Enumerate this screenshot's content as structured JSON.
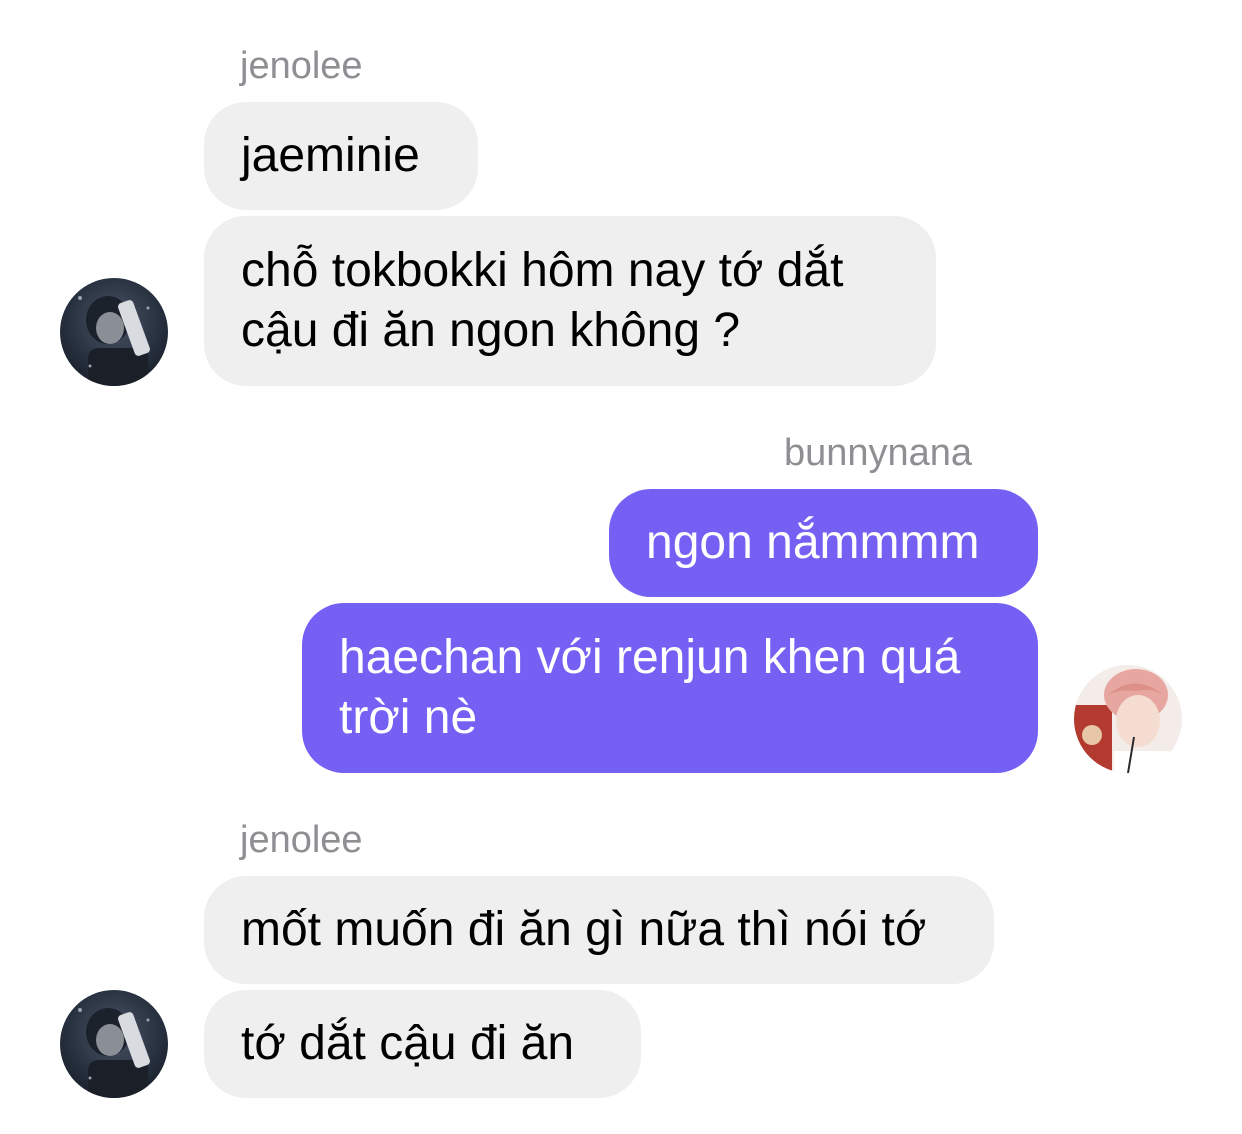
{
  "chat": {
    "group1": {
      "sender": "jenolee",
      "messages": [
        "jaeminie",
        "chỗ tokbokki hôm nay tớ dắt\ncậu đi ăn ngon không ?"
      ],
      "avatar_icon": "user-photo-dark"
    },
    "group2": {
      "sender": "bunnynana",
      "messages": [
        "ngon nắmmmm",
        "haechan với renjun khen quá\ntrời nè"
      ],
      "avatar_icon": "user-photo-pink-hair"
    },
    "group3": {
      "sender": "jenolee",
      "messages": [
        "mốt muốn đi ăn gì nữa thì nói tớ",
        "tớ dắt cậu đi ăn"
      ],
      "avatar_icon": "user-photo-dark"
    }
  },
  "colors": {
    "incoming_bubble": "#efefef",
    "outgoing_bubble": "#7560f4",
    "sender_label": "#8e8e93"
  }
}
